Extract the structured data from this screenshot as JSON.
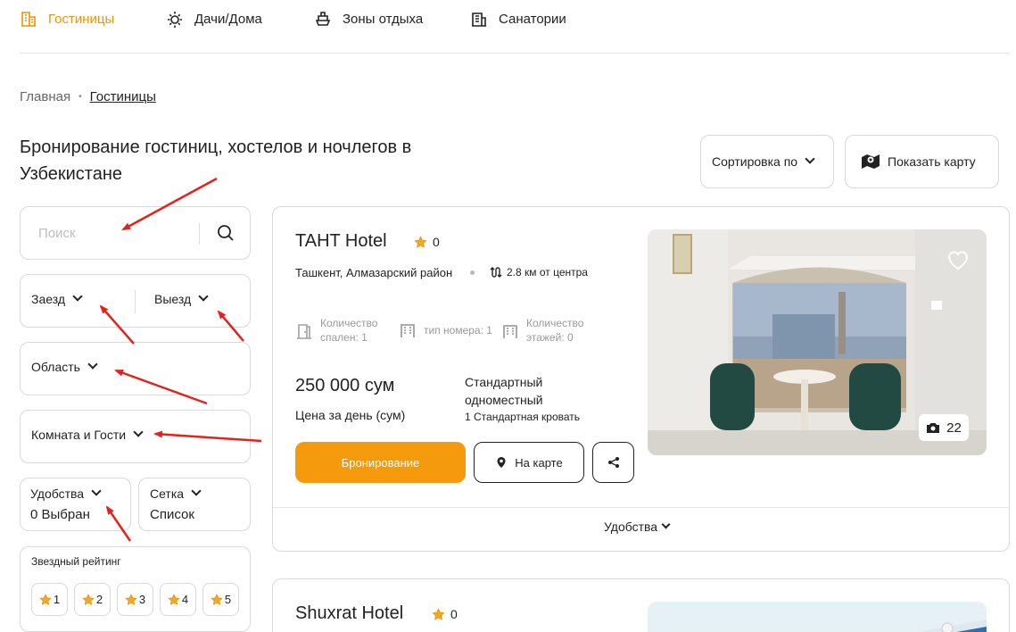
{
  "nav": {
    "items": [
      {
        "label": "Гостиницы",
        "icon": "building-icon",
        "active": true
      },
      {
        "label": "Дачи/Дома",
        "icon": "sun-icon",
        "active": false
      },
      {
        "label": "Зоны отдыха",
        "icon": "ship-icon",
        "active": false
      },
      {
        "label": "Санатории",
        "icon": "clinic-icon",
        "active": false
      }
    ]
  },
  "breadcrumb": {
    "home": "Главная",
    "separator": "•",
    "current": "Гостиницы"
  },
  "page": {
    "title": "Бронирование гостиниц, хостелов и ночлегов в Узбекистане"
  },
  "toolbar": {
    "sort_label": "Сортировка по",
    "map_label": "Показать карту"
  },
  "filters": {
    "search_placeholder": "Поиск",
    "checkin_label": "Заезд",
    "checkout_label": "Выезд",
    "region_label": "Область",
    "room_guests_label": "Комната и Гости",
    "amenities_label": "Удобства",
    "amenities_value": "0 Выбран",
    "grid_label": "Сетка",
    "grid_value": "Список",
    "star_rating_title": "Звездный рейтинг",
    "stars": [
      "1",
      "2",
      "3",
      "4",
      "5"
    ]
  },
  "hotels": [
    {
      "name": "TAHT Hotel",
      "rating": "0",
      "location": "Ташкент, Алмазарский район",
      "distance": "2.8 км от центра",
      "features": [
        {
          "line1": "Количество",
          "line2": "спален: 1",
          "icon": "door-icon"
        },
        {
          "line1": "тип номера: 1",
          "line2": "",
          "icon": "building-grid-icon"
        },
        {
          "line1": "Количество",
          "line2": "этажей: 0",
          "icon": "floors-icon"
        }
      ],
      "price": "250 000 сум",
      "price_note": "Цена за день (сум)",
      "room_type": "Стандартный одноместный",
      "bed_type": "1 Стандартная кровать",
      "book_label": "Бронирование",
      "map_label": "На карте",
      "photo_count": "22",
      "amenities_toggle": "Удобства"
    },
    {
      "name": "Shuxrat Hotel",
      "rating": "0"
    }
  ],
  "colors": {
    "accent": "#f29200",
    "button": "#f59a0c",
    "annotation_arrow": "#e8201a"
  }
}
